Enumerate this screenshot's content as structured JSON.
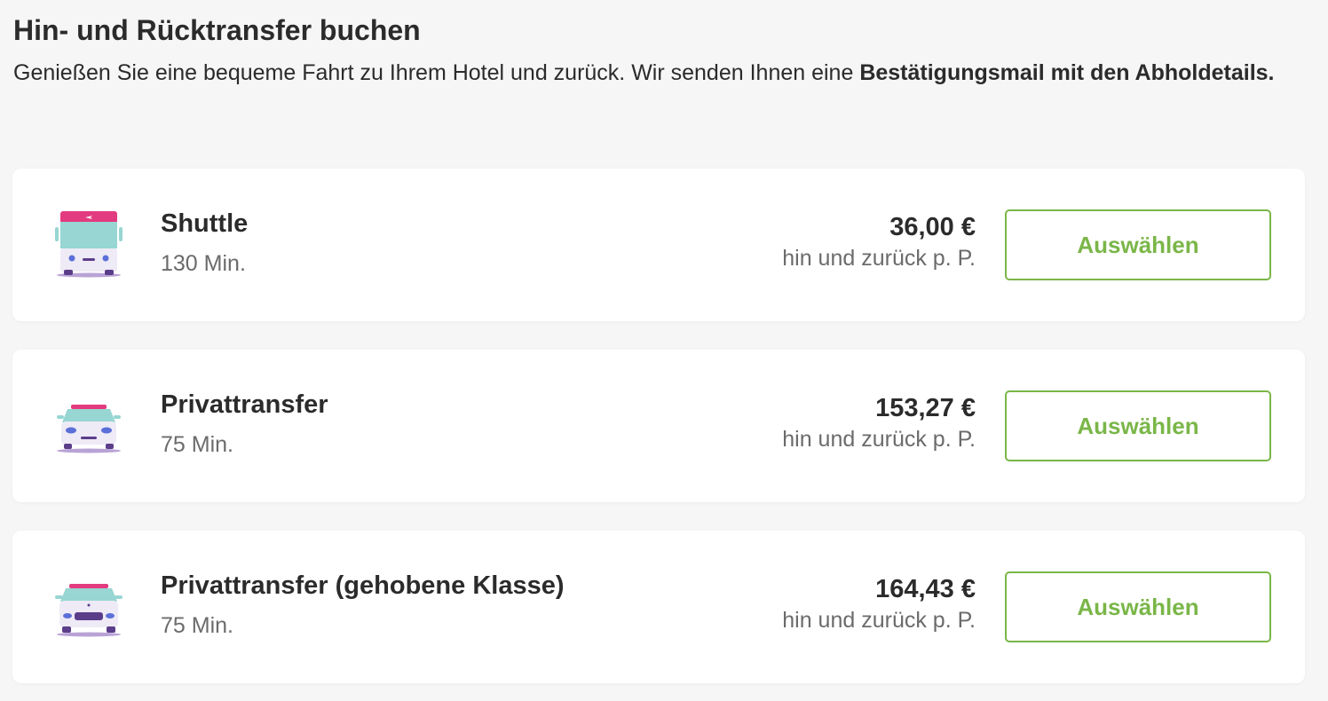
{
  "header": {
    "title": "Hin- und Rücktransfer buchen",
    "intro_text": "Genießen Sie eine bequeme Fahrt zu Ihrem Hotel und zurück. Wir senden Ihnen eine ",
    "intro_bold": "Bestätigungsmail mit den Abholdetails."
  },
  "colors": {
    "accent_green": "#7ab648",
    "vehicle_pink": "#e23b7f",
    "vehicle_teal": "#97d6d2",
    "vehicle_purple": "#5b3d8a"
  },
  "options": [
    {
      "icon": "shuttle-bus-icon",
      "title": "Shuttle",
      "duration": "130 Min.",
      "price": "36,00 €",
      "price_note": "hin und zurück p. P.",
      "button_label": "Auswählen"
    },
    {
      "icon": "private-car-icon",
      "title": "Privattransfer",
      "duration": "75 Min.",
      "price": "153,27 €",
      "price_note": "hin und zurück p. P.",
      "button_label": "Auswählen"
    },
    {
      "icon": "premium-car-icon",
      "title": "Privattransfer (gehobene Klasse)",
      "duration": "75 Min.",
      "price": "164,43 €",
      "price_note": "hin und zurück p. P.",
      "button_label": "Auswählen"
    }
  ]
}
